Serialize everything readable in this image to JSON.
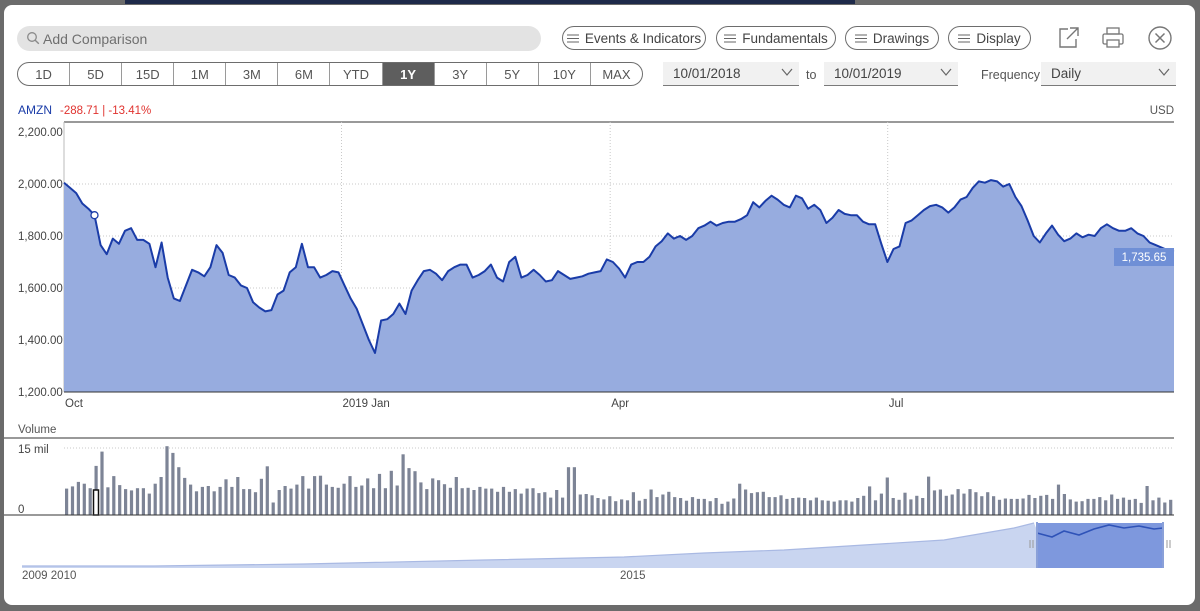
{
  "toolbar": {
    "search_placeholder": "Add Comparison",
    "events_label": "Events & Indicators",
    "fundamentals_label": "Fundamentals",
    "drawings_label": "Drawings",
    "display_label": "Display"
  },
  "ranges": [
    "1D",
    "5D",
    "15D",
    "1M",
    "3M",
    "6M",
    "YTD",
    "1Y",
    "3Y",
    "5Y",
    "10Y",
    "MAX"
  ],
  "active_range": "1Y",
  "date_from": "10/01/2018",
  "date_to_label": "to",
  "date_to": "10/01/2019",
  "frequency_label": "Frequency",
  "frequency_value": "Daily",
  "symbol": "AMZN",
  "change": "-288.71 | -13.41%",
  "currency": "USD",
  "last_price_label": "1,735.65",
  "volume_label": "Volume",
  "colors": {
    "accent": "#1a3ca8",
    "fill": "#97acdf",
    "negative": "#e0332f",
    "badge": "#6f8fd6",
    "volume": "#7d8496"
  },
  "chart_data": {
    "type": "area",
    "x_ticks": [
      "Oct",
      "2019 Jan",
      "Apr",
      "Jul"
    ],
    "y_ticks": [
      "2,200.00",
      "2,000.00",
      "1,800.00",
      "1,600.00",
      "1,400.00",
      "1,200.00"
    ],
    "ylim": [
      1200,
      2200
    ],
    "grid": true,
    "series": [
      {
        "name": "AMZN",
        "points": [
          [
            0,
            2005
          ],
          [
            1,
            1985
          ],
          [
            2,
            1965
          ],
          [
            3,
            1925
          ],
          [
            4,
            1905
          ],
          [
            5,
            1880
          ],
          [
            6,
            1765
          ],
          [
            7,
            1730
          ],
          [
            8,
            1790
          ],
          [
            9,
            1770
          ],
          [
            10,
            1820
          ],
          [
            11,
            1830
          ],
          [
            12,
            1785
          ],
          [
            13,
            1785
          ],
          [
            14,
            1770
          ],
          [
            15,
            1680
          ],
          [
            16,
            1775
          ],
          [
            17,
            1640
          ],
          [
            18,
            1560
          ],
          [
            19,
            1550
          ],
          [
            20,
            1610
          ],
          [
            21,
            1670
          ],
          [
            22,
            1660
          ],
          [
            23,
            1645
          ],
          [
            24,
            1680
          ],
          [
            25,
            1765
          ],
          [
            26,
            1735
          ],
          [
            27,
            1650
          ],
          [
            28,
            1640
          ],
          [
            29,
            1610
          ],
          [
            30,
            1600
          ],
          [
            31,
            1545
          ],
          [
            32,
            1525
          ],
          [
            33,
            1510
          ],
          [
            34,
            1515
          ],
          [
            35,
            1575
          ],
          [
            36,
            1590
          ],
          [
            37,
            1660
          ],
          [
            38,
            1680
          ],
          [
            39,
            1770
          ],
          [
            40,
            1680
          ],
          [
            41,
            1680
          ],
          [
            42,
            1640
          ],
          [
            43,
            1650
          ],
          [
            44,
            1665
          ],
          [
            45,
            1660
          ],
          [
            46,
            1610
          ],
          [
            47,
            1560
          ],
          [
            48,
            1520
          ],
          [
            49,
            1460
          ],
          [
            50,
            1400
          ],
          [
            51,
            1350
          ],
          [
            52,
            1475
          ],
          [
            53,
            1480
          ],
          [
            54,
            1500
          ],
          [
            55,
            1540
          ],
          [
            56,
            1500
          ],
          [
            57,
            1590
          ],
          [
            58,
            1630
          ],
          [
            59,
            1665
          ],
          [
            60,
            1670
          ],
          [
            61,
            1655
          ],
          [
            62,
            1630
          ],
          [
            63,
            1665
          ],
          [
            64,
            1680
          ],
          [
            65,
            1690
          ],
          [
            66,
            1690
          ],
          [
            67,
            1640
          ],
          [
            68,
            1650
          ],
          [
            69,
            1665
          ],
          [
            70,
            1690
          ],
          [
            71,
            1640
          ],
          [
            72,
            1625
          ],
          [
            73,
            1700
          ],
          [
            74,
            1720
          ],
          [
            75,
            1640
          ],
          [
            76,
            1650
          ],
          [
            77,
            1670
          ],
          [
            78,
            1650
          ],
          [
            79,
            1625
          ],
          [
            80,
            1630
          ],
          [
            81,
            1665
          ],
          [
            82,
            1650
          ],
          [
            83,
            1635
          ],
          [
            84,
            1640
          ],
          [
            85,
            1645
          ],
          [
            86,
            1655
          ],
          [
            87,
            1660
          ],
          [
            88,
            1665
          ],
          [
            89,
            1710
          ],
          [
            90,
            1700
          ],
          [
            91,
            1675
          ],
          [
            92,
            1640
          ],
          [
            93,
            1690
          ],
          [
            94,
            1700
          ],
          [
            95,
            1700
          ],
          [
            96,
            1720
          ],
          [
            97,
            1760
          ],
          [
            98,
            1780
          ],
          [
            99,
            1810
          ],
          [
            100,
            1790
          ],
          [
            101,
            1800
          ],
          [
            102,
            1785
          ],
          [
            103,
            1800
          ],
          [
            104,
            1830
          ],
          [
            105,
            1840
          ],
          [
            106,
            1855
          ],
          [
            107,
            1840
          ],
          [
            108,
            1850
          ],
          [
            109,
            1855
          ],
          [
            110,
            1855
          ],
          [
            111,
            1865
          ],
          [
            112,
            1880
          ],
          [
            113,
            1930
          ],
          [
            114,
            1910
          ],
          [
            115,
            1935
          ],
          [
            116,
            1955
          ],
          [
            117,
            1940
          ],
          [
            118,
            1920
          ],
          [
            119,
            1910
          ],
          [
            120,
            1955
          ],
          [
            121,
            1945
          ],
          [
            122,
            1905
          ],
          [
            123,
            1920
          ],
          [
            124,
            1900
          ],
          [
            125,
            1850
          ],
          [
            126,
            1870
          ],
          [
            127,
            1900
          ],
          [
            128,
            1885
          ],
          [
            129,
            1880
          ],
          [
            130,
            1880
          ],
          [
            131,
            1855
          ],
          [
            132,
            1845
          ],
          [
            133,
            1845
          ],
          [
            134,
            1770
          ],
          [
            135,
            1700
          ],
          [
            136,
            1750
          ],
          [
            137,
            1760
          ],
          [
            138,
            1850
          ],
          [
            139,
            1860
          ],
          [
            140,
            1880
          ],
          [
            141,
            1900
          ],
          [
            142,
            1915
          ],
          [
            143,
            1920
          ],
          [
            144,
            1910
          ],
          [
            145,
            1890
          ],
          [
            146,
            1910
          ],
          [
            147,
            1940
          ],
          [
            148,
            1950
          ],
          [
            149,
            1985
          ],
          [
            150,
            2010
          ],
          [
            151,
            2005
          ],
          [
            152,
            2015
          ],
          [
            153,
            2010
          ],
          [
            154,
            1990
          ],
          [
            155,
            2000
          ],
          [
            156,
            1950
          ],
          [
            157,
            1915
          ],
          [
            158,
            1860
          ],
          [
            159,
            1800
          ],
          [
            160,
            1775
          ],
          [
            161,
            1810
          ],
          [
            162,
            1840
          ],
          [
            163,
            1805
          ],
          [
            164,
            1780
          ],
          [
            165,
            1790
          ],
          [
            166,
            1810
          ],
          [
            167,
            1795
          ],
          [
            168,
            1805
          ],
          [
            169,
            1800
          ],
          [
            170,
            1830
          ],
          [
            171,
            1845
          ],
          [
            172,
            1830
          ],
          [
            173,
            1820
          ],
          [
            174,
            1820
          ],
          [
            175,
            1830
          ],
          [
            176,
            1810
          ],
          [
            177,
            1800
          ],
          [
            178,
            1775
          ],
          [
            179,
            1765
          ],
          [
            180,
            1755
          ],
          [
            181,
            1745
          ],
          [
            182,
            1740
          ]
        ]
      }
    ]
  },
  "volume_data": {
    "y_ticks": [
      "15 mil",
      "0"
    ],
    "values": [
      5.9,
      6.4,
      7.4,
      7.0,
      6.0,
      11.0,
      14.2,
      6.2,
      8.7,
      6.7,
      5.8,
      5.5,
      6.0,
      6.0,
      4.8,
      7.0,
      8.5,
      15.4,
      13.9,
      10.7,
      8.3,
      6.8,
      5.3,
      6.3,
      6.5,
      5.3,
      6.3,
      8.0,
      6.3,
      8.5,
      5.8,
      5.8,
      5.1,
      8.1,
      10.9,
      2.8,
      5.6,
      6.5,
      5.9,
      6.8,
      8.7,
      5.9,
      8.7,
      8.8,
      6.8,
      6.3,
      6.1,
      7.0,
      8.7,
      6.3,
      6.6,
      8.2,
      6.0,
      9.2,
      6.0,
      9.9,
      6.6,
      13.6,
      10.5,
      9.8,
      7.3,
      5.8,
      8.2,
      7.8,
      6.9,
      6.1,
      8.5,
      6.0,
      6.1,
      5.6,
      6.3,
      5.9,
      5.9,
      5.2,
      6.3,
      5.2,
      5.8,
      4.8,
      5.9,
      6.0,
      4.9,
      5.1,
      3.9,
      5.6,
      3.9,
      10.7,
      10.7,
      4.6,
      4.7,
      4.4,
      3.8,
      3.5,
      4.2,
      3.1,
      3.5,
      3.3,
      5.1,
      3.2,
      3.6,
      5.7,
      4.0,
      4.6,
      5.2,
      4.0,
      3.8,
      3.2,
      4.0,
      3.6,
      3.6,
      3.1,
      3.8,
      2.5,
      3.0,
      3.7,
      7.0,
      5.7,
      4.9,
      5.1,
      5.2,
      4.0,
      4.0,
      4.4,
      3.6,
      3.8,
      3.9,
      3.8,
      3.3,
      3.9,
      3.3,
      3.2,
      3.0,
      3.3,
      3.3,
      3.0,
      3.8,
      4.3,
      6.4,
      3.3,
      4.8,
      8.4,
      3.8,
      3.4,
      5.0,
      3.5,
      4.3,
      3.8,
      8.6,
      5.5,
      5.7,
      4.3,
      4.6,
      5.8,
      4.8,
      5.8,
      5.1,
      4.2,
      5.1,
      4.2,
      3.4,
      3.7,
      3.6,
      3.6,
      3.7,
      4.5,
      3.8,
      4.3,
      4.5,
      3.6,
      6.8,
      4.7,
      3.5,
      3.0,
      3.1,
      3.6,
      3.6,
      4.0,
      3.3,
      4.6,
      3.6,
      3.9,
      3.4,
      3.6,
      2.7,
      6.5,
      3.3,
      3.9,
      2.8,
      3.4
    ]
  },
  "navigator": {
    "labels": [
      "2009 2010",
      "2015"
    ]
  }
}
